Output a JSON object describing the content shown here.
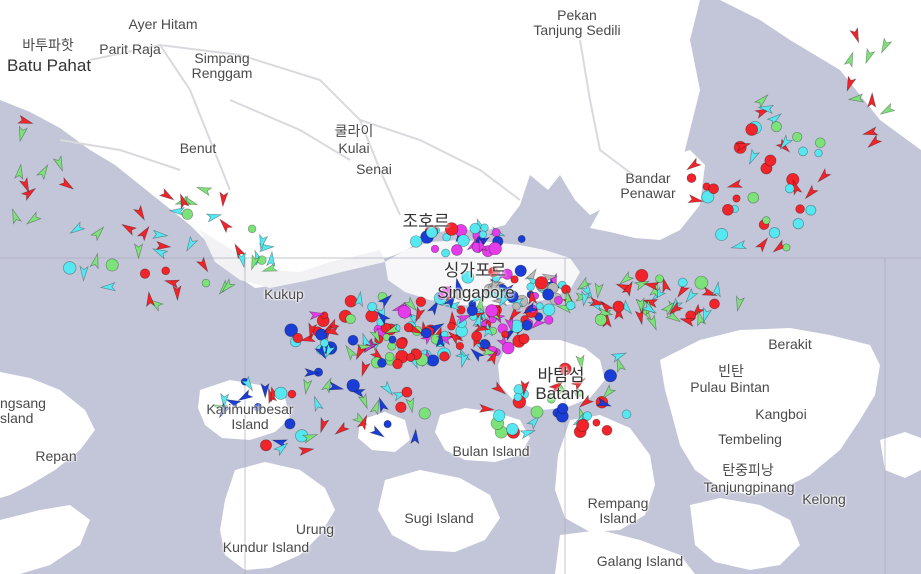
{
  "map": {
    "colors": {
      "water": "#c3c5d8",
      "land": "#ffffff",
      "land_dark": "#f2f2f4",
      "road": "#d9d9de",
      "grid": "#a9abbe",
      "vessel_red": "#f0242a",
      "vessel_green": "#7ee27b",
      "vessel_cyan": "#56e7f0",
      "vessel_blue": "#1a3dd6",
      "vessel_magenta": "#e33ce8",
      "vessel_orange": "#f5a140",
      "vessel_grey": "#b9b9b9"
    },
    "labels": {
      "ayer_hitam": "Ayer Hitam",
      "batu_pahat_ko": "바투파핫",
      "batu_pahat": "Batu Pahat",
      "parit_raja": "Parit Raja",
      "simpang_renggam_1": "Simpang",
      "simpang_renggam_2": "Renggam",
      "pekan_tanjung_1": "Pekan",
      "pekan_tanjung_2": "Tanjung Sedili",
      "kulai_ko": "쿨라이",
      "kulai": "Kulai",
      "benut": "Benut",
      "senai": "Senai",
      "bandar_penawar_1": "Bandar",
      "bandar_penawar_2": "Penawar",
      "johor_ko": "조호르",
      "singapore_ko": "싱가포르",
      "singapore": "Singapore",
      "kukup": "Kukup",
      "berakit": "Berakit",
      "bintan_ko": "빈탄",
      "pulau_bintan": "Pulau Bintan",
      "batam_ko": "바탐섬",
      "batam": "Batam",
      "kangboi": "Kangboi",
      "tembeling": "Tembeling",
      "karimun_1": "Karimunbesar",
      "karimun_2": "Island",
      "ngsang_1": "ngsang",
      "ngsang_2": "sland",
      "bulan_island": "Bulan Island",
      "repan": "Repan",
      "tanjungpinang_ko": "탄중피낭",
      "tanjungpinang": "Tanjungpinang",
      "kelong": "Kelong",
      "urung": "Urung",
      "sugi_island": "Sugi Island",
      "rempang_1": "Rempang",
      "rempang_2": "Island",
      "kundur_island": "Kundur Island",
      "galang_island": "Galang Island"
    }
  }
}
